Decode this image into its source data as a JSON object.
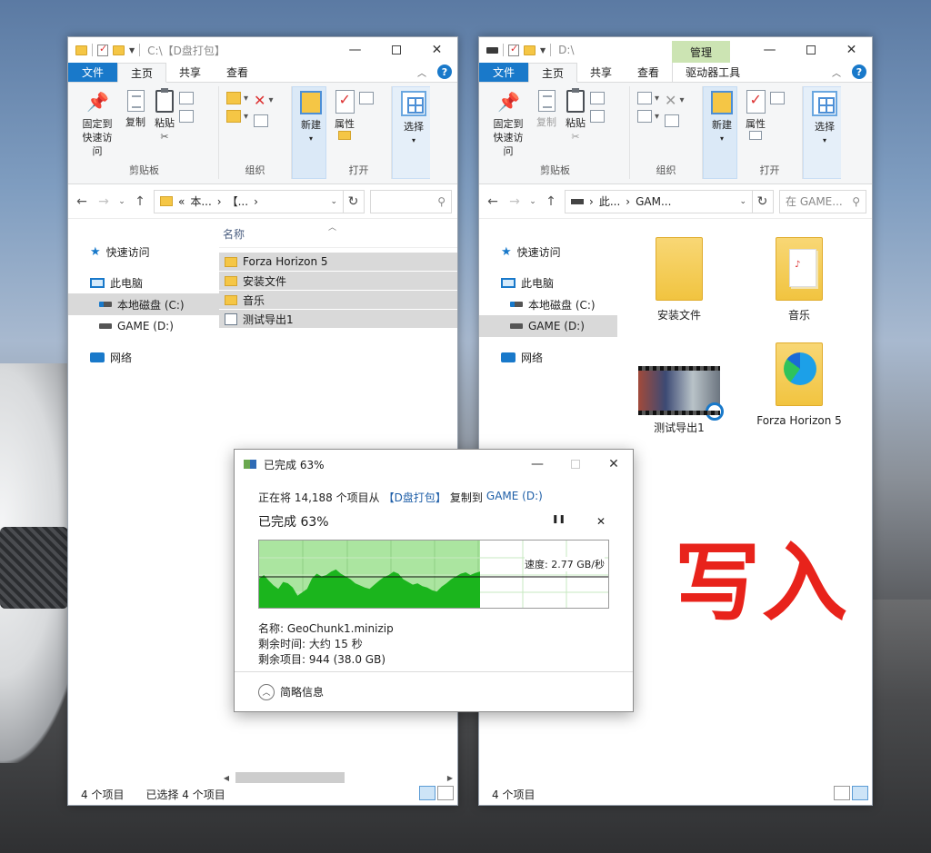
{
  "colors": {
    "accent": "#1979ca",
    "progress_done": "#abe5a0",
    "throughput": "#1bb51d",
    "overlay": "#e8231b",
    "manage_tab": "#cce4b3"
  },
  "left_window": {
    "title": "C:\\【D盘打包】",
    "tabs": {
      "file": "文件",
      "home": "主页",
      "share": "共享",
      "view": "查看"
    },
    "ribbon": {
      "pin": "固定到快速访问",
      "copy": "复制",
      "paste": "粘贴",
      "clipboard_group": "剪贴板",
      "organize_group": "组织",
      "new": "新建",
      "properties": "属性",
      "open_group": "打开",
      "select": "选择"
    },
    "address": {
      "prefix": "«",
      "part1": "本...",
      "part2": "【...",
      "sep": "›"
    },
    "search_placeholder": "",
    "nav": {
      "quick": "快速访问",
      "pc": "此电脑",
      "c_drive": "本地磁盘 (C:)",
      "d_drive": "GAME (D:)",
      "network": "网络"
    },
    "column_name": "名称",
    "files": [
      {
        "name": "Forza Horizon 5",
        "kind": "folder"
      },
      {
        "name": "安装文件",
        "kind": "folder"
      },
      {
        "name": "音乐",
        "kind": "folder"
      },
      {
        "name": "测试导出1",
        "kind": "video"
      }
    ],
    "status": {
      "count": "4 个项目",
      "selected": "已选择 4 个项目"
    }
  },
  "right_window": {
    "title": "D:\\",
    "manage": "管理",
    "tabs": {
      "file": "文件",
      "home": "主页",
      "share": "共享",
      "view": "查看",
      "drive_tools": "驱动器工具"
    },
    "ribbon": {
      "pin": "固定到快速访问",
      "copy": "复制",
      "paste": "粘贴",
      "clipboard_group": "剪贴板",
      "organize_group": "组织",
      "new": "新建",
      "properties": "属性",
      "open_group": "打开",
      "select": "选择"
    },
    "address": {
      "part1": "此...",
      "part2": "GAM...",
      "sep": "›"
    },
    "search_placeholder": "在 GAME...",
    "nav": {
      "quick": "快速访问",
      "pc": "此电脑",
      "c_drive": "本地磁盘 (C:)",
      "d_drive": "GAME (D:)",
      "network": "网络"
    },
    "tiles": [
      {
        "name": "安装文件",
        "kind": "folder"
      },
      {
        "name": "音乐",
        "kind": "music-folder"
      },
      {
        "name": "测试导出1",
        "kind": "video"
      },
      {
        "name": "Forza Horizon 5",
        "kind": "edge-folder"
      }
    ],
    "status": {
      "count": "4 个项目"
    }
  },
  "copy_dialog": {
    "title": "已完成 63%",
    "line_prefix": "正在将 14,188 个项目从",
    "source": "【D盘打包】",
    "line_mid": "复制到",
    "dest": "GAME (D:)",
    "percent_text": "已完成 63%",
    "pause_symbol": "❚❚",
    "cancel_symbol": "✕",
    "progress": 0.63,
    "speed": "速度: 2.77 GB/秒",
    "name_line": "名称: GeoChunk1.minizip",
    "time_left": "剩余时间: 大约 15 秒",
    "items_left": "剩余项目: 944 (38.0 GB)",
    "more_less": "简略信息",
    "throughput_samples": [
      0.45,
      0.5,
      0.42,
      0.35,
      0.3,
      0.4,
      0.38,
      0.32,
      0.2,
      0.25,
      0.3,
      0.45,
      0.52,
      0.48,
      0.5,
      0.55,
      0.58,
      0.52,
      0.48,
      0.44,
      0.38,
      0.35,
      0.32,
      0.3,
      0.36,
      0.42,
      0.47,
      0.5,
      0.55,
      0.52,
      0.44,
      0.4,
      0.36,
      0.38,
      0.34,
      0.32,
      0.28,
      0.26,
      0.33,
      0.38,
      0.44,
      0.48,
      0.52,
      0.54,
      0.5,
      0.53,
      0.55
    ]
  },
  "overlay_text": "写入"
}
